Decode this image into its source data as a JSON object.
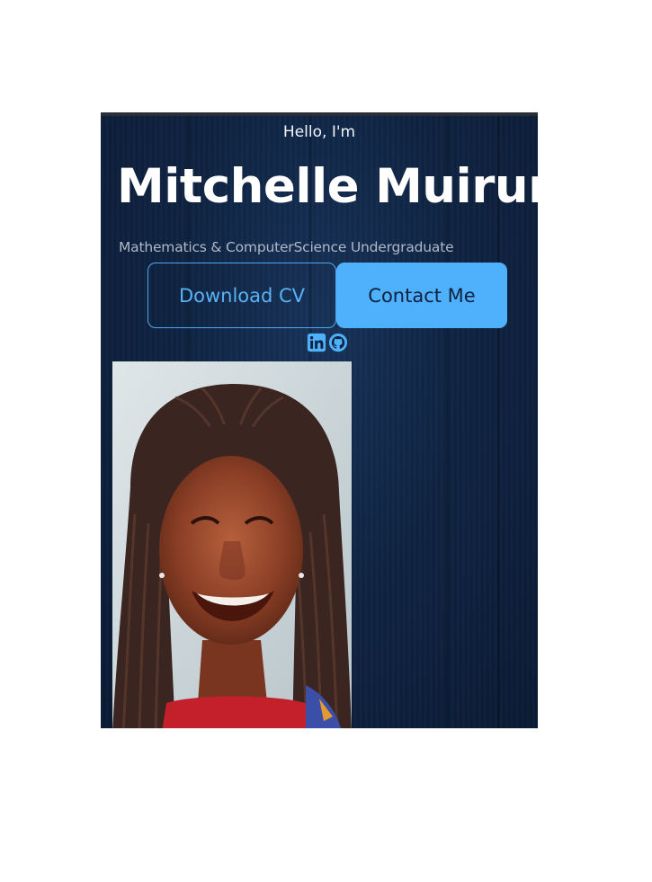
{
  "hero": {
    "greeting": "Hello, I'm",
    "name": "Mitchelle Muiruri",
    "subtitle": "Mathematics & ComputerScience Undergraduate"
  },
  "buttons": {
    "download_cv": "Download CV",
    "contact_me": "Contact Me"
  },
  "socials": [
    {
      "icon": "linkedin-icon"
    },
    {
      "icon": "github-icon"
    }
  ],
  "colors": {
    "background": "#0f2443",
    "accent": "#4fb0fb",
    "heading": "#ffffff",
    "subtitle": "#aeb8c6"
  }
}
